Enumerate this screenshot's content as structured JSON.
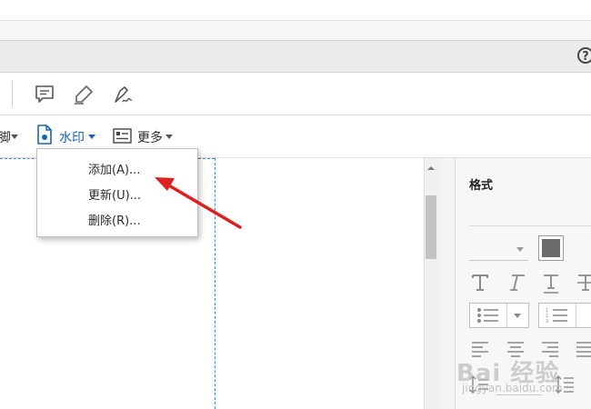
{
  "help": {
    "label": "?"
  },
  "edit_toolbar": {
    "header_footer_partial": "脚",
    "watermark_label": "水印",
    "more_label": "更多"
  },
  "watermark_menu": {
    "items": [
      {
        "label": "添加(A)..."
      },
      {
        "label": "更新(U)..."
      },
      {
        "label": "删除(R)..."
      }
    ]
  },
  "format_panel": {
    "title": "格式"
  },
  "brand": {
    "name": "Bai 经验",
    "url": "jingyan.baidu.com"
  },
  "colors": {
    "accent_blue": "#1a64b8",
    "annotation_red": "#e02020",
    "swatch_fill": "#6b6b6b"
  },
  "icons": {
    "toolbar": [
      "comment-icon",
      "highlight-icon",
      "sign-icon"
    ],
    "panel": [
      "text-bold-icon",
      "text-italic-icon",
      "text-underline-icon",
      "text-strike-icon"
    ]
  }
}
